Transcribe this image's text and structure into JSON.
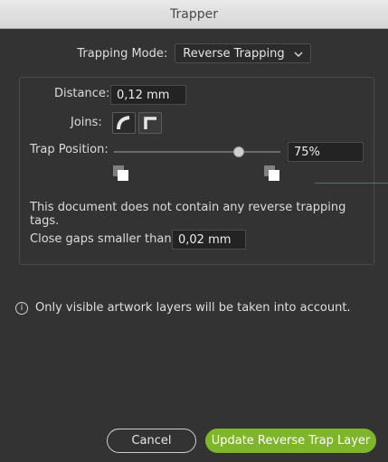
{
  "window": {
    "title": "Trapper"
  },
  "mode": {
    "label": "Trapping Mode:",
    "value": "Reverse Trapping"
  },
  "distance": {
    "label": "Distance:",
    "value": "0,12 mm"
  },
  "joins": {
    "label": "Joins:"
  },
  "trap_position": {
    "label": "Trap Position:",
    "value": "75%",
    "level_percent": 75
  },
  "message": "This document does not contain any reverse trapping tags.",
  "close_gaps": {
    "label": "Close gaps smaller than:",
    "value": "0,02 mm"
  },
  "info": {
    "text": "Only visible artwork layers will be taken into account."
  },
  "buttons": {
    "cancel": "Cancel",
    "primary": "Update Reverse Trap Layer"
  },
  "colors": {
    "accent": "#7fb52a",
    "background": "#333333"
  }
}
